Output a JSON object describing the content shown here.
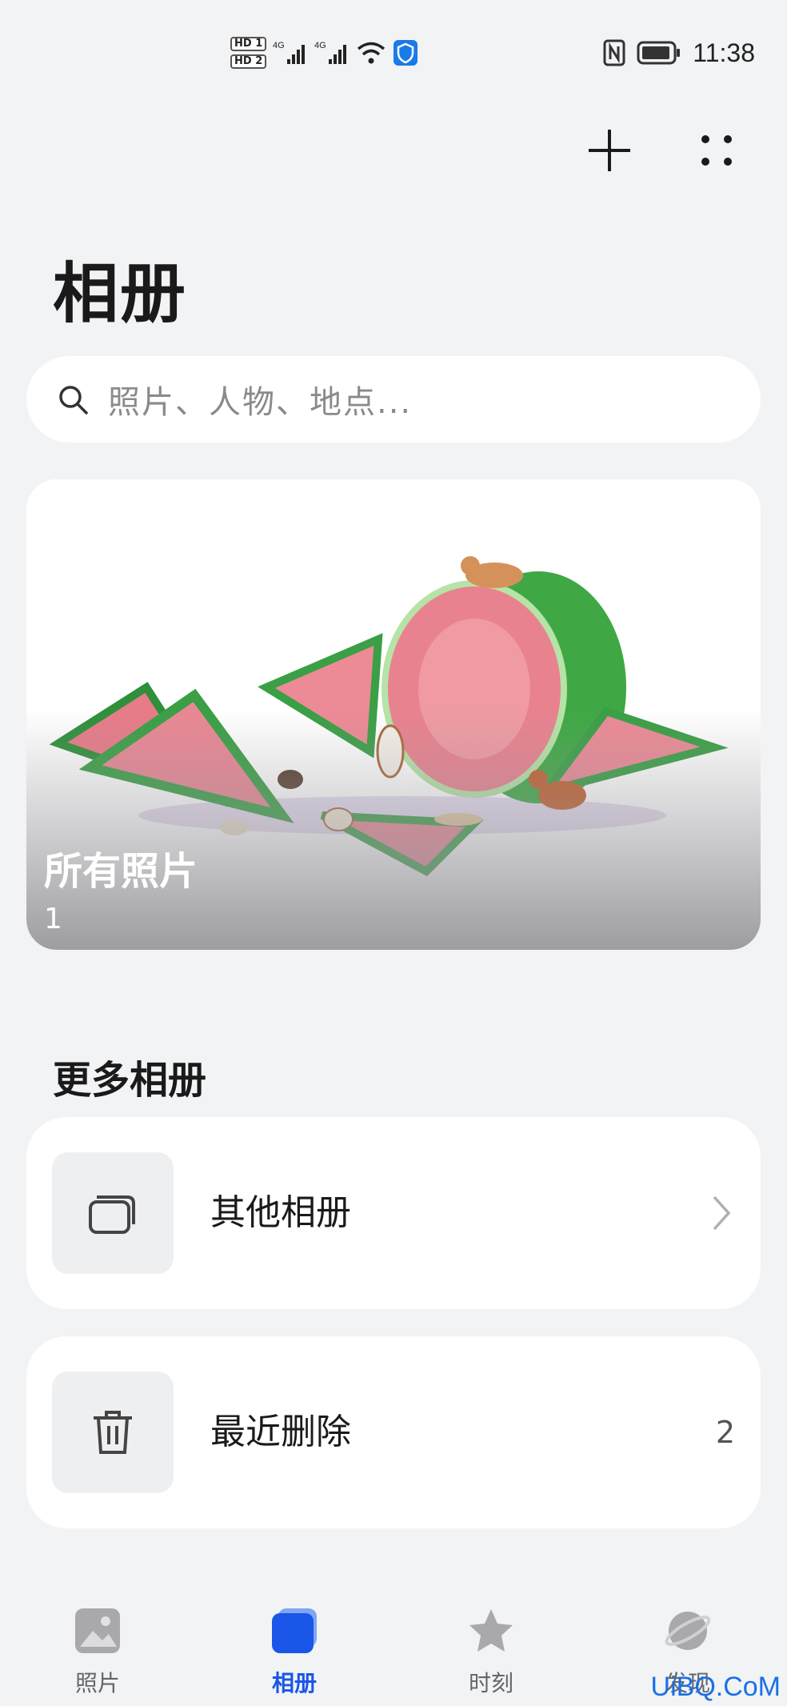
{
  "status_bar": {
    "hd1": "HD 1",
    "hd2": "HD 2",
    "net1": "4G",
    "net2": "4G",
    "time": "11:38"
  },
  "header": {
    "title": "相册",
    "add_icon": "plus-icon",
    "more_icon": "more-dots-icon"
  },
  "search": {
    "placeholder": "照片、人物、地点..."
  },
  "hero_album": {
    "title": "所有照片",
    "count": "1"
  },
  "more_albums": {
    "title": "更多相册",
    "items": [
      {
        "label": "其他相册",
        "icon": "stacked-albums-icon",
        "trailing": "chevron-right-icon"
      },
      {
        "label": "最近删除",
        "icon": "trash-icon",
        "count": "2"
      }
    ]
  },
  "tabs": [
    {
      "label": "照片",
      "icon": "photo-icon",
      "active": false
    },
    {
      "label": "相册",
      "icon": "album-icon",
      "active": true
    },
    {
      "label": "时刻",
      "icon": "star-icon",
      "active": false
    },
    {
      "label": "发现",
      "icon": "planet-icon",
      "active": false
    }
  ],
  "colors": {
    "accent": "#1a56e8",
    "background": "#f1f3f5",
    "card": "#ffffff"
  },
  "watermark": "UiBQ.CoM"
}
